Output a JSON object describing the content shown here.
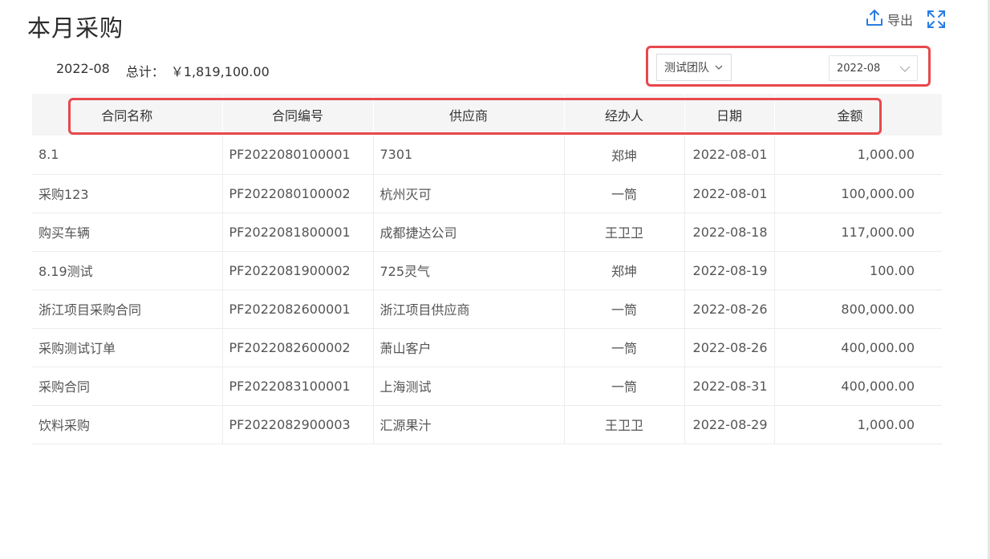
{
  "page": {
    "title": "本月采购"
  },
  "toolbar": {
    "export_label": "导出",
    "export_icon": "upload-icon",
    "fullscreen_icon": "expand-icon",
    "accent": "#2a7de1"
  },
  "summary": {
    "month": "2022-08",
    "total_label": "总计：",
    "total_value": "￥1,819,100.00"
  },
  "filters": {
    "team": "测试团队",
    "month": "2022-08"
  },
  "table": {
    "headers": [
      "合同名称",
      "合同编号",
      "供应商",
      "经办人",
      "日期",
      "金额"
    ],
    "rows": [
      [
        "8.1",
        "PF2022080100001",
        "7301",
        "郑坤",
        "2022-08-01",
        "1,000.00"
      ],
      [
        "采购123",
        "PF2022080100002",
        "杭州灭可",
        "一筒",
        "2022-08-01",
        "100,000.00"
      ],
      [
        "购买车辆",
        "PF2022081800001",
        "成都捷达公司",
        "王卫卫",
        "2022-08-18",
        "117,000.00"
      ],
      [
        "8.19测试",
        "PF2022081900002",
        "725灵气",
        "郑坤",
        "2022-08-19",
        "100.00"
      ],
      [
        "浙江项目采购合同",
        "PF2022082600001",
        "浙江项目供应商",
        "一筒",
        "2022-08-26",
        "800,000.00"
      ],
      [
        "采购测试订单",
        "PF2022082600002",
        "萧山客户",
        "一筒",
        "2022-08-26",
        "400,000.00"
      ],
      [
        "采购合同",
        "PF2022083100001",
        "上海测试",
        "一筒",
        "2022-08-31",
        "400,000.00"
      ],
      [
        "饮料采购",
        "PF2022082900003",
        "汇源果汁",
        "王卫卫",
        "2022-08-29",
        "1,000.00"
      ]
    ]
  },
  "highlight_color": "#e8484c"
}
